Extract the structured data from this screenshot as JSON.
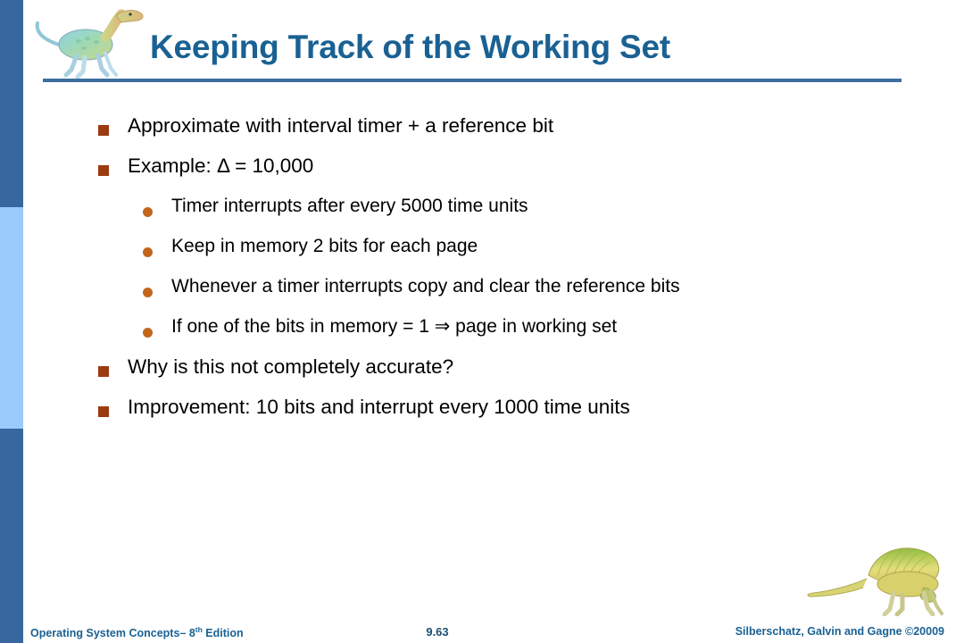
{
  "slide": {
    "title": "Keeping Track of the Working Set",
    "accent_color": "#1A6193",
    "rule_color": "#3C6E9F",
    "sidebar": {
      "band_top_color": "#36679E",
      "band_mid_color": "#9BCBFC",
      "band_bottom_color": "#36679E"
    },
    "bullet_marker_color": "#9C3A12",
    "subbullet_marker_color": "#C2661C"
  },
  "icons": {
    "title_dino": "dinosaur-icon",
    "bottom_dino": "dinosaur-icon"
  },
  "bullets": [
    {
      "level": 1,
      "text": "Approximate with interval timer + a reference bit"
    },
    {
      "level": 1,
      "text": "Example: Δ = 10,000"
    },
    {
      "level": 2,
      "text": "Timer interrupts after every 5000 time units"
    },
    {
      "level": 2,
      "text": "Keep in memory 2 bits for each page"
    },
    {
      "level": 2,
      "text": "Whenever a timer interrupts copy and clear the reference bits"
    },
    {
      "level": 2,
      "text": "If one of the bits in memory = 1 ⇒ page in working set"
    },
    {
      "level": 1,
      "text": "Why is this not completely accurate?"
    },
    {
      "level": 1,
      "text": "Improvement: 10 bits and interrupt every 1000 time units"
    }
  ],
  "footer": {
    "left_prefix": "Operating System Concepts– 8",
    "left_sup": "th",
    "left_suffix": " Edition",
    "page_number": "9.63",
    "right": "Silberschatz, Galvin and Gagne ©20009"
  }
}
